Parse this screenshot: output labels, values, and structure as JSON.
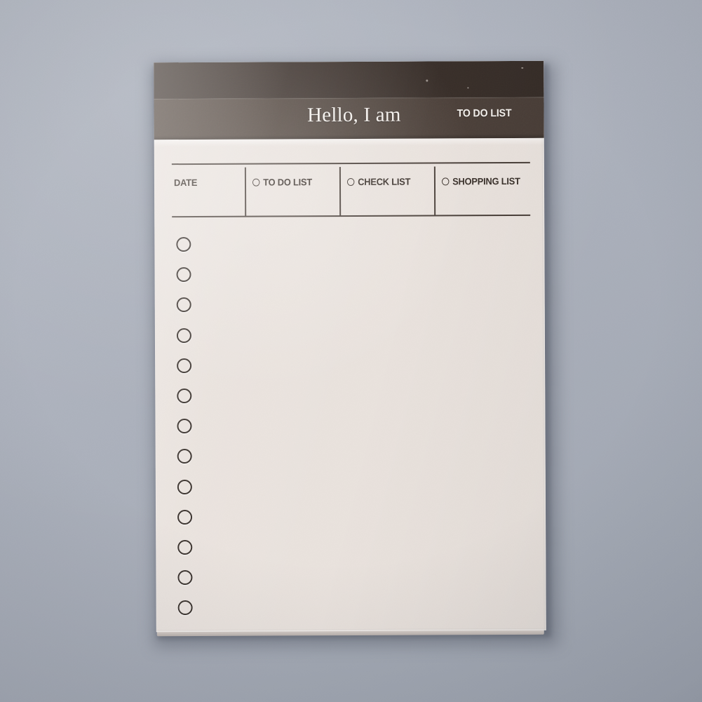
{
  "scene": {
    "background_color": "#aeb4bf",
    "object": "to-do-list-notepad",
    "paper_color": "#eae3de"
  },
  "notepad": {
    "header": {
      "band_top_color": "#3a302b",
      "band_bottom_color": "#4d423b",
      "greeting": "Hello, I am",
      "badge_label": "TO DO LIST"
    },
    "table": {
      "rule_color": "#4a403a",
      "columns": [
        {
          "label": "DATE",
          "has_bullet": false
        },
        {
          "label": "TO DO LIST",
          "has_bullet": true
        },
        {
          "label": "CHECK LIST",
          "has_bullet": true
        },
        {
          "label": "SHOPPING LIST",
          "has_bullet": true
        }
      ]
    },
    "checklist": {
      "bullet_icon": "circle-outline-icon",
      "bullet_color": "#332b26",
      "count": 13,
      "rows": [
        {
          "index": 1,
          "text": ""
        },
        {
          "index": 2,
          "text": ""
        },
        {
          "index": 3,
          "text": ""
        },
        {
          "index": 4,
          "text": ""
        },
        {
          "index": 5,
          "text": ""
        },
        {
          "index": 6,
          "text": ""
        },
        {
          "index": 7,
          "text": ""
        },
        {
          "index": 8,
          "text": ""
        },
        {
          "index": 9,
          "text": ""
        },
        {
          "index": 10,
          "text": ""
        },
        {
          "index": 11,
          "text": ""
        },
        {
          "index": 12,
          "text": ""
        },
        {
          "index": 13,
          "text": ""
        }
      ]
    }
  }
}
